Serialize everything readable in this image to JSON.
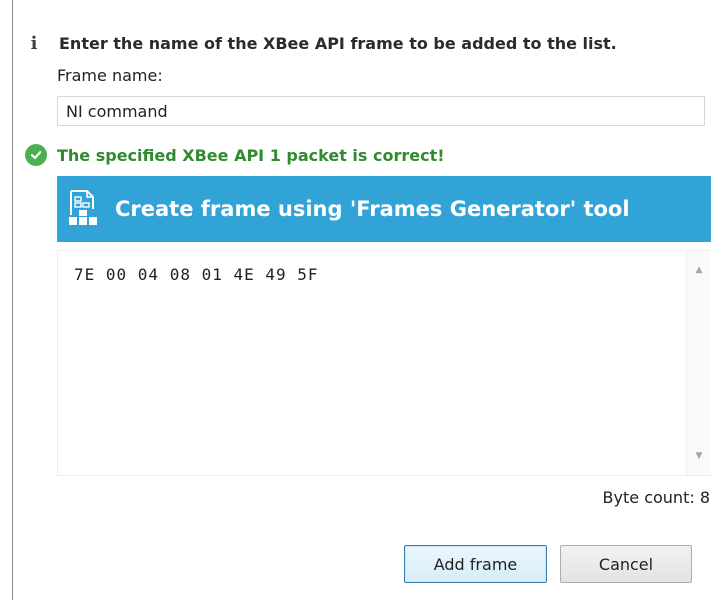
{
  "info": {
    "icon": "info-icon",
    "message": "Enter the name of the XBee API frame to be added to the list."
  },
  "frame_name": {
    "label": "Frame name:",
    "value": "NI command"
  },
  "validation": {
    "icon": "check-circle-icon",
    "message": "The specified XBee API 1 packet is correct!",
    "color": "#2e8b2e"
  },
  "generator": {
    "icon": "frames-generator-icon",
    "label": "Create frame using 'Frames Generator' tool",
    "color": "#31a3d6"
  },
  "hex": {
    "value": "7E 00 04 08 01 4E 49 5F"
  },
  "byte_count": {
    "text": "Byte count: 8"
  },
  "buttons": {
    "add_label": "Add frame",
    "cancel_label": "Cancel"
  }
}
